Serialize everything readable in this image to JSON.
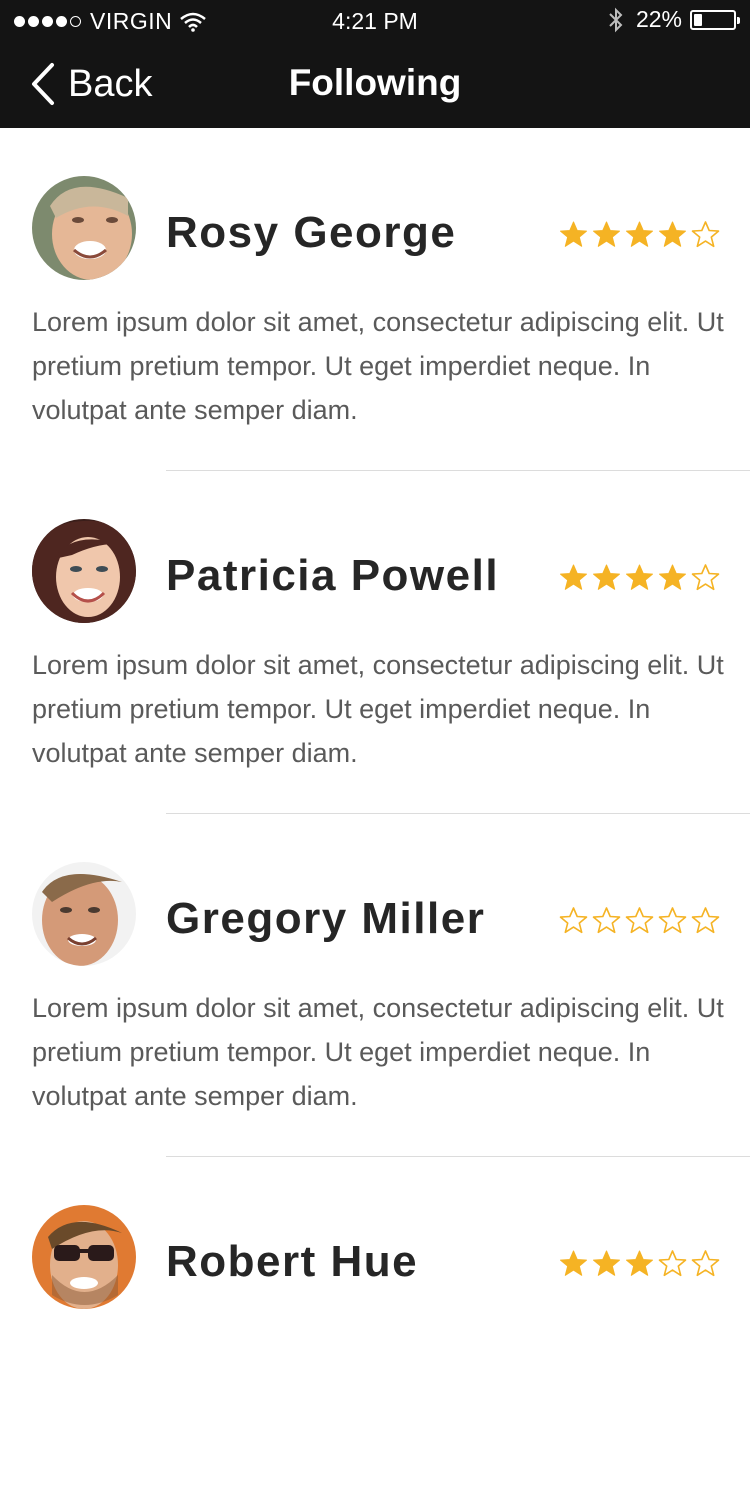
{
  "status_bar": {
    "carrier": "VIRGIN",
    "time": "4:21 PM",
    "battery": "22%",
    "battery_level": 0.22
  },
  "nav": {
    "back_label": "Back",
    "title": "Following"
  },
  "colors": {
    "bar_bg": "#141414",
    "star": "#f5b324",
    "name_text": "#262626",
    "body_text": "#5a5a5a"
  },
  "people": [
    {
      "name": "Rosy George",
      "rating": 4,
      "max_rating": 5,
      "text": "Lorem ipsum dolor sit amet, consectetur adipiscing elit. Ut pretium pretium tempor. Ut eget imperdiet neque. In volutpat ante semper diam."
    },
    {
      "name": "Patricia Powell",
      "rating": 4,
      "max_rating": 5,
      "text": "Lorem ipsum dolor sit amet, consectetur adipiscing elit. Ut pretium pretium tempor. Ut eget imperdiet neque. In volutpat ante semper diam."
    },
    {
      "name": "Gregory Miller",
      "rating": 0,
      "max_rating": 5,
      "text": "Lorem ipsum dolor sit amet, consectetur adipiscing elit. Ut pretium pretium tempor. Ut eget imperdiet neque. In volutpat ante semper diam."
    },
    {
      "name": "Robert Hue",
      "rating": 3,
      "max_rating": 5,
      "text": ""
    }
  ]
}
